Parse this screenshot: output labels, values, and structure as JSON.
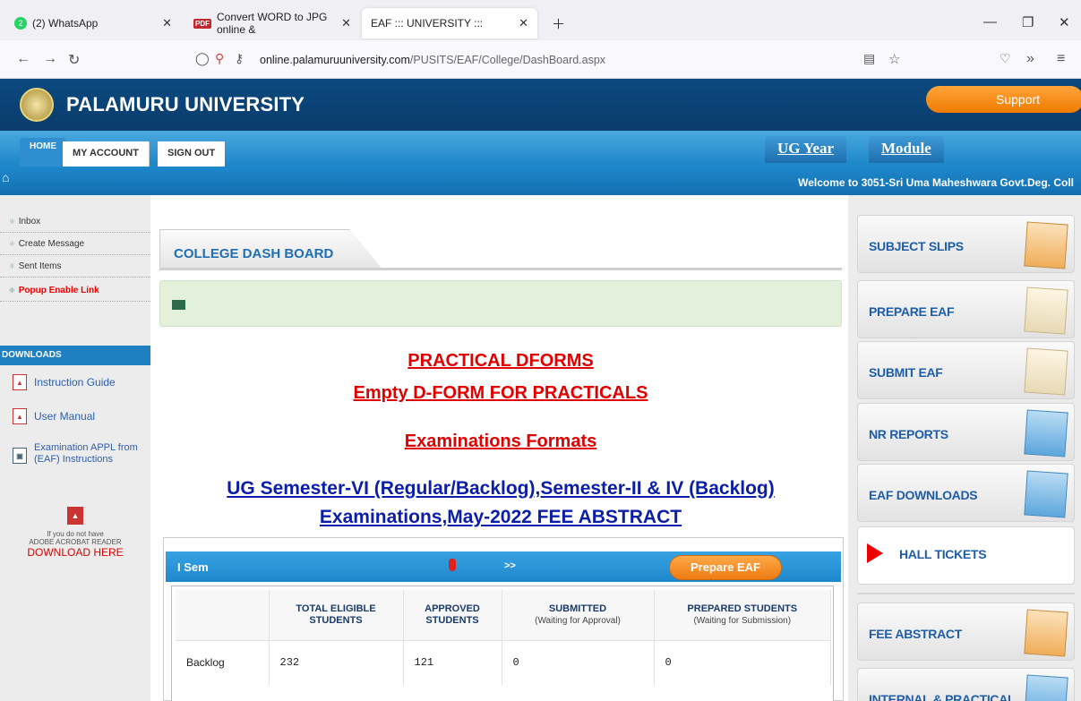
{
  "browser": {
    "tabs": [
      {
        "label": "(2) WhatsApp",
        "badge": "2"
      },
      {
        "label": "Convert WORD to JPG online &",
        "icon_text": "PDF"
      },
      {
        "label": "EAF ::: UNIVERSITY :::"
      }
    ],
    "url_host": "online.palamuruuniversity.com",
    "url_path": "/PUSITS/EAF/College/DashBoard.aspx"
  },
  "header": {
    "title": "PALAMURU UNIVERSITY",
    "support": "Support"
  },
  "menu": {
    "home": "HOME",
    "account": "MY ACCOUNT",
    "signout": "SIGN OUT",
    "ug_year": "UG Year",
    "module": "Module"
  },
  "welcome": "Welcome to 3051-Sri Uma Maheshwara Govt.Deg. Coll",
  "sidebar": {
    "links": [
      "Inbox",
      "Create Message",
      "Sent Items",
      "Popup Enable Link"
    ],
    "downloads_title": "DOWNLOADS",
    "downloads": [
      "Instruction Guide",
      "User Manual",
      "Examination APPL from",
      "(EAF) Instructions"
    ],
    "adobe_line1": "If you do not have",
    "adobe_line2": "ADOBE ACROBAT READER",
    "adobe_link": "DOWNLOAD HERE"
  },
  "main": {
    "dash_title": "COLLEGE DASH BOARD",
    "links": {
      "practical": "PRACTICAL DFORMS",
      "empty_dform": "Empty D-FORM FOR PRACTICALS",
      "exam_formats": "Examinations Formats",
      "ug_line1": "UG Semester-VI (Regular/Backlog),Semester-II & IV (Backlog)",
      "ug_line2": "Examinations,May-2022 FEE ABSTRACT"
    },
    "sem": {
      "title": "I Sem",
      "arrows": ">>",
      "prepare": "Prepare EAF",
      "headers": [
        {
          "main": "TOTAL ELIGIBLE",
          "main2": "STUDENTS",
          "sub": ""
        },
        {
          "main": "APPROVED",
          "main2": "STUDENTS",
          "sub": ""
        },
        {
          "main": "SUBMITTED",
          "main2": "",
          "sub": "(Waiting for Approval)"
        },
        {
          "main": "PREPARED STUDENTS",
          "main2": "",
          "sub": "(Waiting for Submission)"
        }
      ],
      "rows": [
        {
          "label": "Backlog",
          "total": "232",
          "approved": "121",
          "submitted": "0",
          "prepared": "0"
        }
      ]
    }
  },
  "right": {
    "cards": [
      "SUBJECT SLIPS",
      "PREPARE EAF",
      "SUBMIT EAF",
      "NR REPORTS",
      "EAF DOWNLOADS",
      "HALL TICKETS",
      "FEE ABSTRACT",
      "INTERNAL & PRACTICAL"
    ]
  }
}
